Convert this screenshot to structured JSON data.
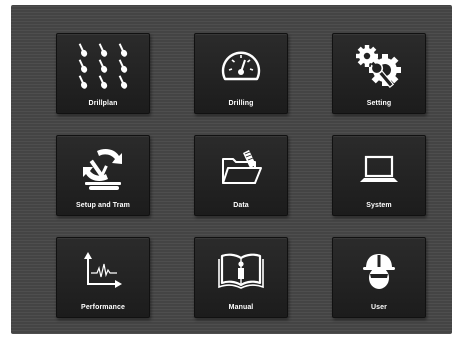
{
  "tiles": [
    {
      "id": "drillplan",
      "label": "Drillplan",
      "icon": "drill-bits-grid-icon"
    },
    {
      "id": "drilling",
      "label": "Drilling",
      "icon": "speedometer-icon"
    },
    {
      "id": "setting",
      "label": "Setting",
      "icon": "gears-wrench-icon"
    },
    {
      "id": "setup-and-tram",
      "label": "Setup and Tram",
      "icon": "rig-rotate-icon"
    },
    {
      "id": "data",
      "label": "Data",
      "icon": "open-folder-icon"
    },
    {
      "id": "system",
      "label": "System",
      "icon": "laptop-icon"
    },
    {
      "id": "performance",
      "label": "Performance",
      "icon": "chart-axes-icon"
    },
    {
      "id": "manual",
      "label": "Manual",
      "icon": "book-info-icon"
    },
    {
      "id": "user",
      "label": "User",
      "icon": "hardhat-worker-icon"
    }
  ],
  "colors": {
    "panel": "#4a4a4a",
    "tile": "#222222",
    "icon": "#ffffff",
    "text": "#ffffff"
  }
}
